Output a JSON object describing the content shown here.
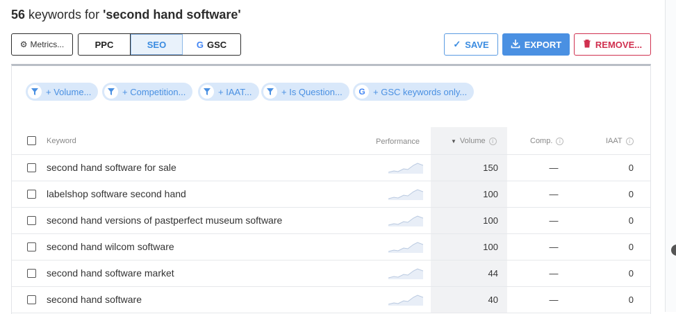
{
  "header": {
    "count": "56",
    "text": " keywords for ",
    "query": "'second hand software'"
  },
  "toolbar": {
    "metrics_label": "Metrics...",
    "tabs": [
      {
        "label": "PPC"
      },
      {
        "label": "SEO"
      },
      {
        "label": "GSC"
      }
    ],
    "save_label": "SAVE",
    "export_label": "EXPORT",
    "remove_label": "REMOVE..."
  },
  "filters": [
    {
      "label": "+ Volume...",
      "icon": "filter-icon"
    },
    {
      "label": "+ Competition...",
      "icon": "filter-icon"
    },
    {
      "label": "+ IAAT...",
      "icon": "filter-icon"
    },
    {
      "label": "+ Is Question...",
      "icon": "filter-icon"
    },
    {
      "label": "+ GSC keywords only...",
      "icon": "google-icon"
    }
  ],
  "table": {
    "columns": {
      "keyword": "Keyword",
      "performance": "Performance",
      "volume": "Volume",
      "comp": "Comp.",
      "iaat": "IAAT"
    },
    "rows": [
      {
        "keyword": "second hand software for sale",
        "volume": "150",
        "comp": "—",
        "iaat": "0"
      },
      {
        "keyword": "labelshop software second hand",
        "volume": "100",
        "comp": "—",
        "iaat": "0"
      },
      {
        "keyword": "second hand versions of pastperfect museum software",
        "volume": "100",
        "comp": "—",
        "iaat": "0"
      },
      {
        "keyword": "second hand wilcom software",
        "volume": "100",
        "comp": "—",
        "iaat": "0"
      },
      {
        "keyword": "second hand software market",
        "volume": "44",
        "comp": "—",
        "iaat": "0"
      },
      {
        "keyword": "second hand software",
        "volume": "40",
        "comp": "—",
        "iaat": "0"
      }
    ]
  },
  "colors": {
    "accent": "#4a90e2",
    "danger": "#d0304f"
  }
}
